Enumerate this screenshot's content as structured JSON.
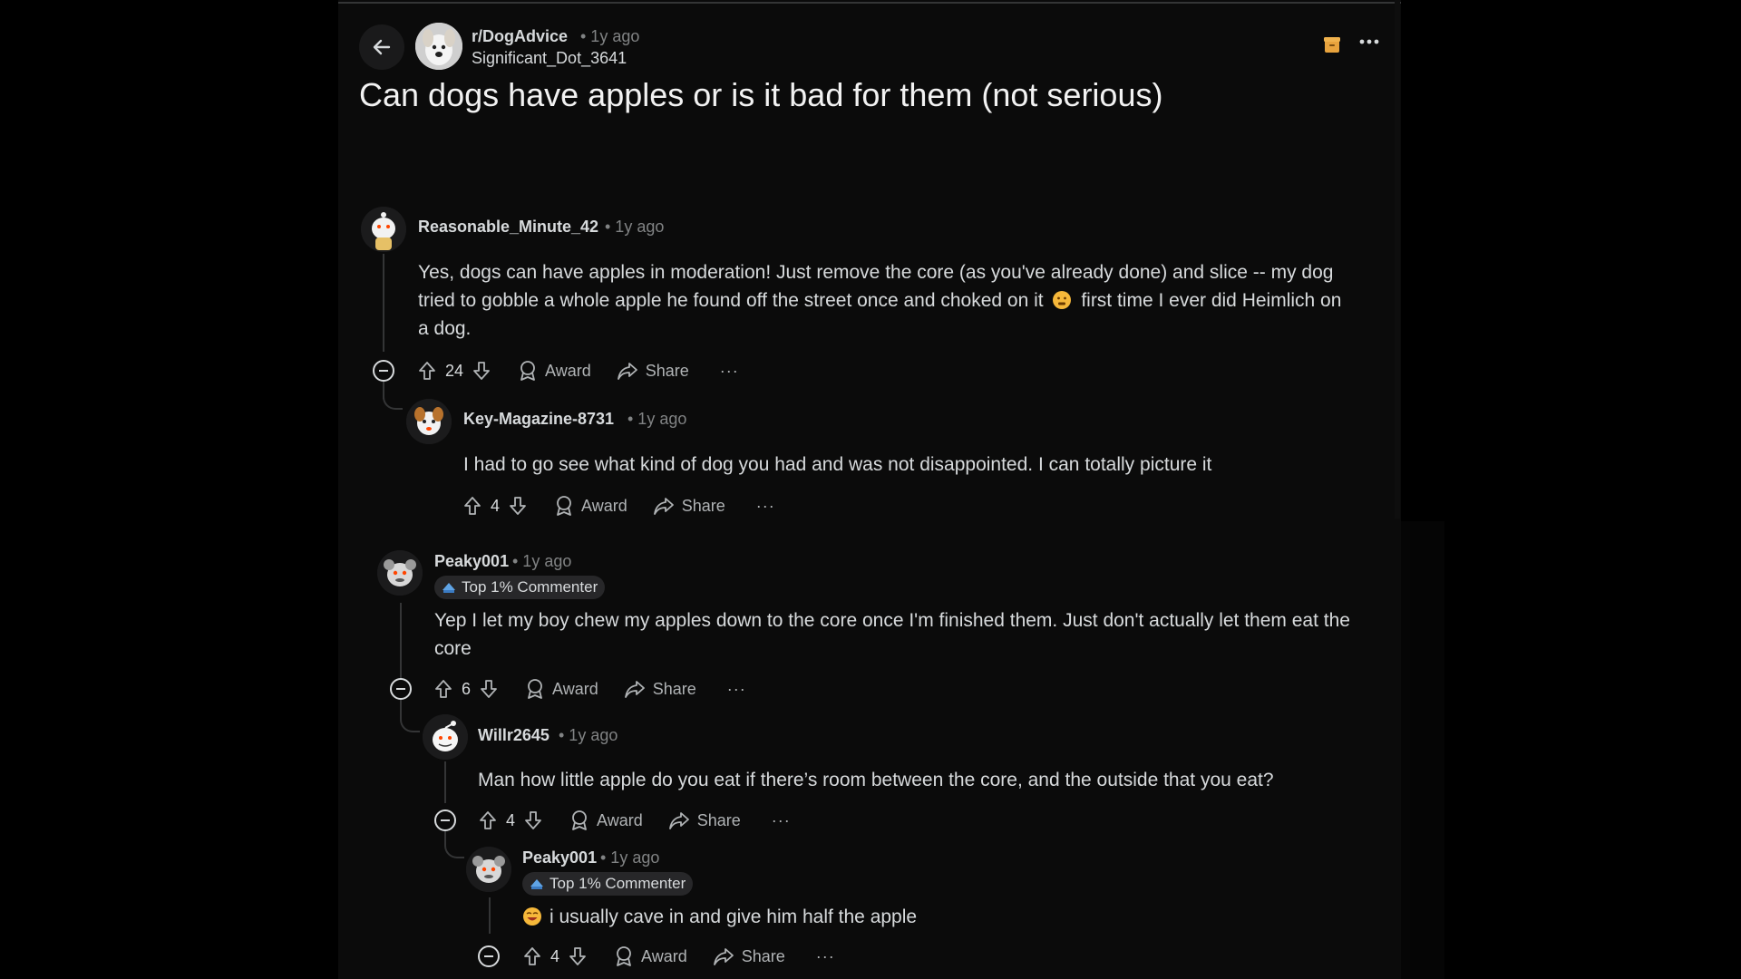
{
  "post": {
    "subreddit": "r/DogAdvice",
    "time": "• 1y ago",
    "author": "Significant_Dot_3641",
    "title": "Can dogs have apples or is it bad for them (not serious)"
  },
  "labels": {
    "award": "Award",
    "share": "Share",
    "more": "···"
  },
  "comments": [
    {
      "user": "Reasonable_Minute_42",
      "time": "• 1y ago",
      "body_1": "Yes, dogs can have apples in moderation! Just remove the core (as you've already done) and slice -- my dog",
      "body_2a": "tried to gobble a whole apple he found off the street once and choked on it",
      "body_2b": "first time I ever did Heimlich on",
      "body_3": "a dog.",
      "score": "24"
    },
    {
      "user": "Key-Magazine-8731",
      "time": "• 1y ago",
      "body": "I had to go see what kind of dog you had and was not disappointed. I can totally picture it",
      "score": "4"
    },
    {
      "user": "Peaky001",
      "time": "• 1y ago",
      "flair": "Top 1% Commenter",
      "body_1": "Yep I let my boy chew my apples down to the core once I'm finished them. Just don't actually let them eat the",
      "body_2": "core",
      "score": "6"
    },
    {
      "user": "Willr2645",
      "time": "• 1y ago",
      "body": "Man how little apple do you eat if there’s room between the core, and the outside that you eat?",
      "score": "4"
    },
    {
      "user": "Peaky001",
      "time": "• 1y ago",
      "flair": "Top 1% Commenter",
      "body": "i usually cave in and give him half the apple",
      "score": "4"
    }
  ],
  "colors": {
    "background": "#000000",
    "panel": "#0b0b0b",
    "text": "#d7dadc",
    "muted": "#818384",
    "archive": "#e8a33d"
  }
}
